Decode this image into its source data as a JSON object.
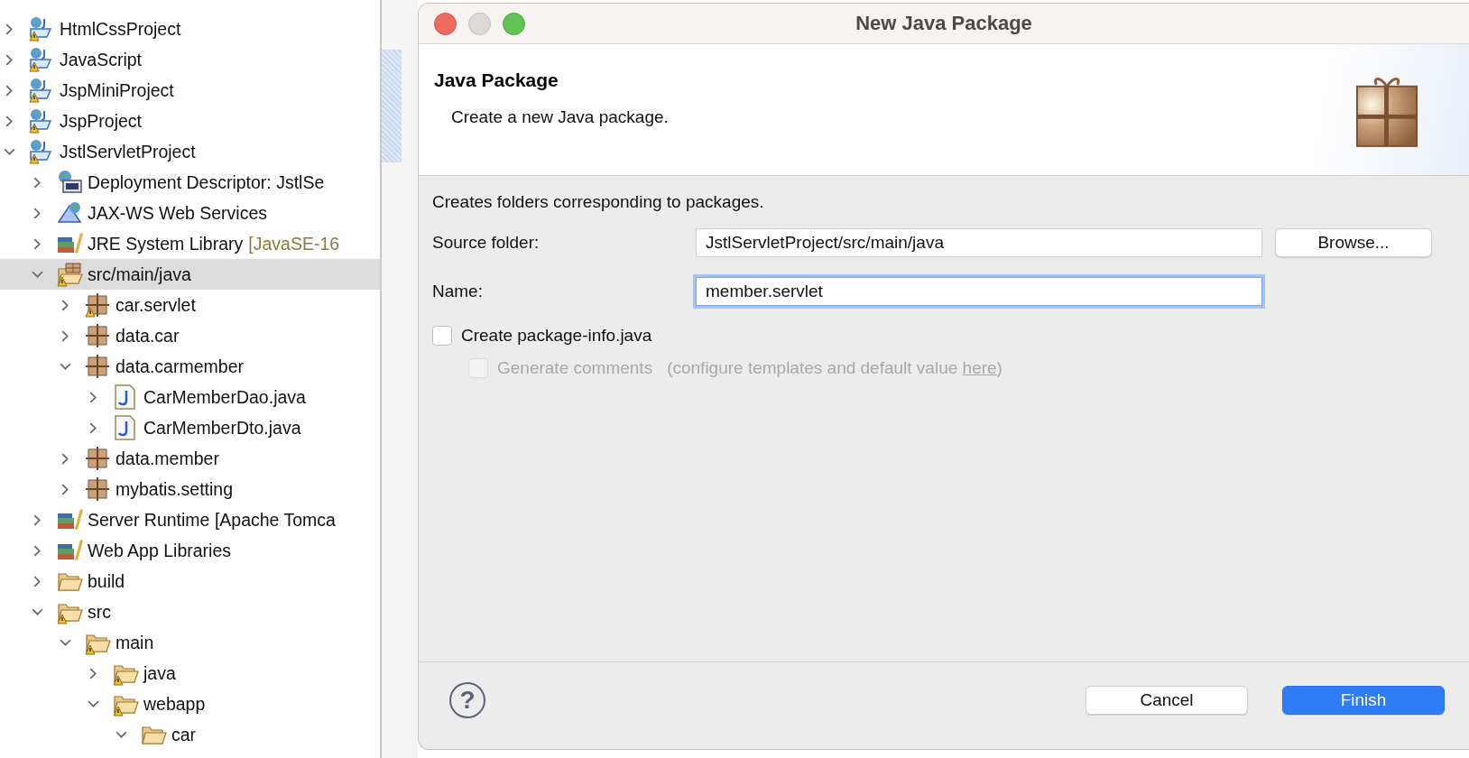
{
  "project_tree": {
    "items": [
      {
        "label": "HtmlCssProject",
        "kind": "project",
        "warning": true,
        "expanded": false,
        "selected": false
      },
      {
        "label": "JavaScript",
        "kind": "project",
        "warning": true,
        "expanded": false,
        "selected": false
      },
      {
        "label": "JspMiniProject",
        "kind": "project",
        "warning": true,
        "expanded": false,
        "selected": false
      },
      {
        "label": "JspProject",
        "kind": "project",
        "warning": true,
        "expanded": false,
        "selected": false
      },
      {
        "label": "JstlServletProject",
        "kind": "project",
        "warning": true,
        "expanded": true,
        "selected": false,
        "children": [
          {
            "label": "Deployment Descriptor: JstlSe",
            "kind": "descriptor",
            "warning": false,
            "expanded": false,
            "selected": false
          },
          {
            "label": "JAX-WS Web Services",
            "kind": "webservice",
            "warning": false,
            "expanded": false,
            "selected": false
          },
          {
            "label": "JRE System Library",
            "decoration": "[JavaSE-16",
            "kind": "library",
            "warning": false,
            "expanded": false,
            "selected": false
          },
          {
            "label": "src/main/java",
            "kind": "sourcefolder",
            "warning": true,
            "expanded": true,
            "selected": true,
            "children": [
              {
                "label": "car.servlet",
                "kind": "package",
                "warning": true,
                "expanded": false,
                "selected": false
              },
              {
                "label": "data.car",
                "kind": "package",
                "warning": false,
                "expanded": false,
                "selected": false
              },
              {
                "label": "data.carmember",
                "kind": "package",
                "warning": false,
                "expanded": true,
                "selected": false,
                "children": [
                  {
                    "label": "CarMemberDao.java",
                    "kind": "javafile",
                    "warning": false,
                    "expanded": false,
                    "selected": false
                  },
                  {
                    "label": "CarMemberDto.java",
                    "kind": "javafile",
                    "warning": false,
                    "expanded": false,
                    "selected": false
                  }
                ]
              },
              {
                "label": "data.member",
                "kind": "package",
                "warning": false,
                "expanded": false,
                "selected": false
              },
              {
                "label": "mybatis.setting",
                "kind": "package",
                "warning": false,
                "expanded": false,
                "selected": false
              }
            ]
          },
          {
            "label": "Server Runtime [Apache Tomca",
            "kind": "library",
            "warning": false,
            "expanded": false,
            "selected": false
          },
          {
            "label": "Web App Libraries",
            "kind": "library",
            "warning": false,
            "expanded": false,
            "selected": false
          },
          {
            "label": "build",
            "kind": "folder",
            "warning": false,
            "expanded": false,
            "selected": false
          },
          {
            "label": "src",
            "kind": "folder",
            "warning": true,
            "expanded": true,
            "selected": false,
            "children": [
              {
                "label": "main",
                "kind": "folder",
                "warning": true,
                "expanded": true,
                "selected": false,
                "children": [
                  {
                    "label": "java",
                    "kind": "folder",
                    "warning": true,
                    "expanded": false,
                    "selected": false
                  },
                  {
                    "label": "webapp",
                    "kind": "folder",
                    "warning": true,
                    "expanded": true,
                    "selected": false,
                    "children": [
                      {
                        "label": "car",
                        "kind": "folder",
                        "warning": false,
                        "expanded": true,
                        "selected": false
                      }
                    ]
                  }
                ]
              }
            ]
          }
        ]
      }
    ]
  },
  "dialog": {
    "title": "New Java Package",
    "header": {
      "title": "Java Package",
      "description": "Create a new Java package."
    },
    "intro": "Creates folders corresponding to packages.",
    "source_folder": {
      "label": "Source folder:",
      "value": "JstlServletProject/src/main/java",
      "button": "Browse..."
    },
    "name": {
      "label": "Name:",
      "value": "member.servlet",
      "focused": true
    },
    "create_package_info": {
      "label": "Create package-info.java",
      "checked": false,
      "disabled": false
    },
    "generate_comments": {
      "label": "Generate comments",
      "checked": false,
      "disabled": true,
      "hint": "(configure templates and default value ",
      "link": "here",
      "hint_end": ")"
    },
    "help": "?",
    "buttons": [
      {
        "label": "Cancel",
        "kind": "secondary"
      },
      {
        "label": "Finish",
        "kind": "default"
      }
    ]
  }
}
